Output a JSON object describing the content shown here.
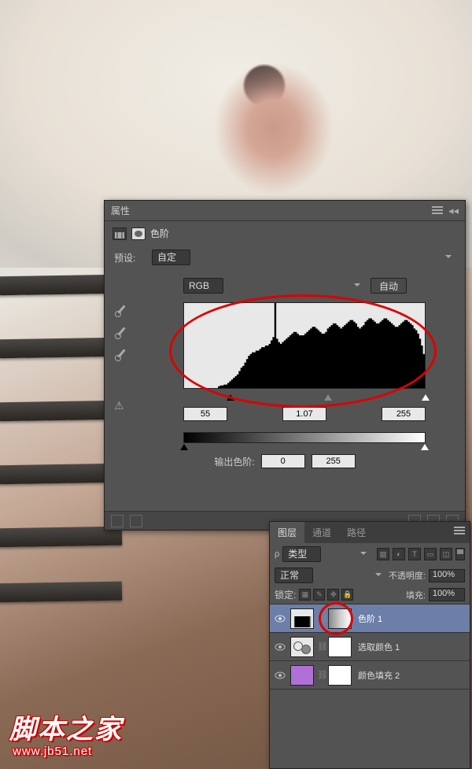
{
  "watermark": {
    "title": "脚本之家",
    "url": "www.jb51.net"
  },
  "properties": {
    "tab": "属性",
    "adjustment_type": "色阶",
    "preset_label": "预设:",
    "preset_value": "自定",
    "channel": "RGB",
    "auto_btn": "自动",
    "input_shadow": "55",
    "input_mid": "1.07",
    "input_highlight": "255",
    "output_label": "输出色阶:",
    "output_low": "0",
    "output_high": "255"
  },
  "chart_data": {
    "type": "histogram",
    "title": "RGB Levels Histogram",
    "xlabel": "",
    "ylabel": "",
    "x_range": [
      0,
      255
    ],
    "input_sliders": {
      "shadow": 55,
      "midtone_gamma": 1.07,
      "highlight": 255
    },
    "output_sliders": {
      "low": 0,
      "high": 255
    },
    "bins": [
      0,
      0,
      0,
      0,
      0,
      0,
      0,
      0,
      0,
      0,
      0,
      0,
      0,
      0,
      0,
      0,
      0,
      0,
      2,
      3,
      3,
      4,
      4,
      6,
      8,
      10,
      12,
      14,
      16,
      20,
      24,
      26,
      30,
      34,
      38,
      40,
      42,
      42,
      44,
      44,
      46,
      48,
      48,
      50,
      50,
      52,
      56,
      60,
      100,
      58,
      54,
      52,
      54,
      56,
      58,
      60,
      62,
      64,
      66,
      66,
      64,
      62,
      62,
      62,
      64,
      66,
      68,
      70,
      72,
      72,
      70,
      68,
      66,
      64,
      64,
      66,
      70,
      72,
      74,
      76,
      76,
      74,
      72,
      70,
      72,
      74,
      76,
      78,
      80,
      80,
      78,
      76,
      72,
      70,
      72,
      74,
      78,
      80,
      82,
      82,
      80,
      78,
      76,
      76,
      78,
      80,
      82,
      82,
      80,
      78,
      76,
      74,
      72,
      72,
      74,
      76,
      78,
      80,
      80,
      78,
      76,
      74,
      70,
      68,
      64,
      58,
      50,
      40
    ]
  },
  "layers": {
    "tabs": [
      "图层",
      "通道",
      "路径"
    ],
    "kind": "类型",
    "blend_mode": "正常",
    "opacity_label": "不透明度:",
    "opacity_value": "100%",
    "lock_label": "锁定:",
    "fill_label": "填充:",
    "fill_value": "100%",
    "items": [
      {
        "name": "色阶 1"
      },
      {
        "name": "选取颜色 1"
      },
      {
        "name": "颜色填充 2"
      }
    ]
  }
}
